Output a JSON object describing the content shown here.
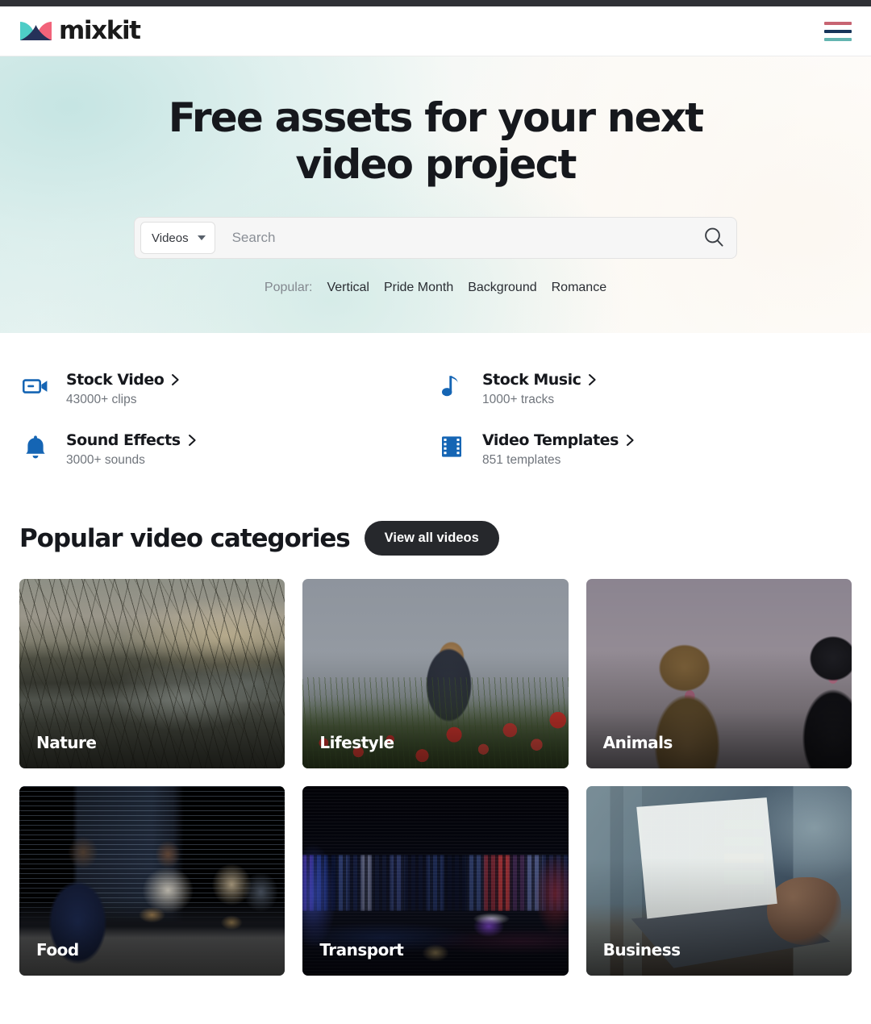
{
  "brand": {
    "name": "mixkit",
    "logo_colors": {
      "teal": "#4ecdc7",
      "pink": "#f2637a",
      "navy": "#253159"
    },
    "menu_colors": {
      "pink": "#c76472",
      "navy": "#17355a",
      "teal": "#63b4b0"
    }
  },
  "header": {
    "menu_label": "menu-icon"
  },
  "hero": {
    "title": "Free assets for your next video project",
    "search": {
      "type_selected": "Videos",
      "placeholder": "Search",
      "search_icon": "search-icon"
    },
    "popular": {
      "label": "Popular:",
      "tags": [
        "Vertical",
        "Pride Month",
        "Background",
        "Romance"
      ]
    }
  },
  "assets": [
    {
      "icon": "video-camera-icon",
      "title": "Stock Video",
      "subtitle": "43000+ clips",
      "color": "#1565b4"
    },
    {
      "icon": "music-note-icon",
      "title": "Stock Music",
      "subtitle": "1000+ tracks",
      "color": "#1565b4"
    },
    {
      "icon": "bell-icon",
      "title": "Sound Effects",
      "subtitle": "3000+ sounds",
      "color": "#1565b4"
    },
    {
      "icon": "film-strip-icon",
      "title": "Video Templates",
      "subtitle": "851 templates",
      "color": "#1565b4"
    }
  ],
  "categories_section": {
    "title": "Popular video categories",
    "view_all_label": "View all videos",
    "cards": [
      {
        "label": "Nature",
        "art": "art-nature"
      },
      {
        "label": "Lifestyle",
        "art": "art-lifestyle"
      },
      {
        "label": "Animals",
        "art": "art-animals"
      },
      {
        "label": "Food",
        "art": "art-food"
      },
      {
        "label": "Transport",
        "art": "art-transport"
      },
      {
        "label": "Business",
        "art": "art-business"
      }
    ]
  }
}
